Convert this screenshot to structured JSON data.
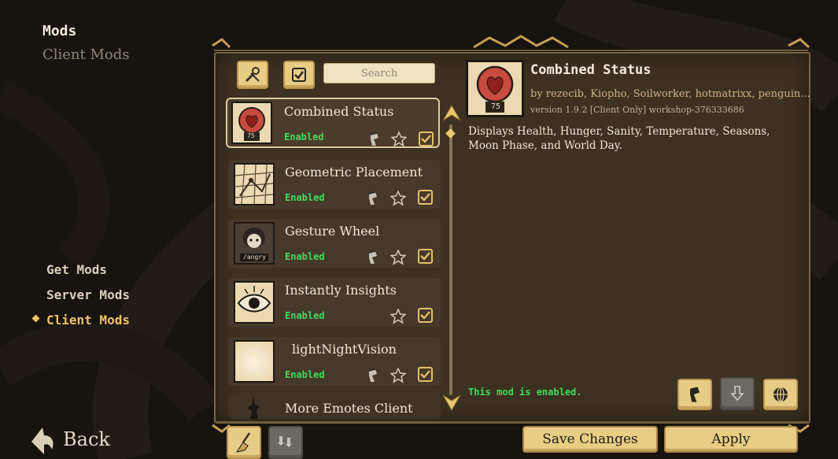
{
  "header": {
    "title": "Mods",
    "subtitle": "Client Mods"
  },
  "nav": {
    "items": [
      {
        "label": "Get Mods",
        "active": false
      },
      {
        "label": "Server Mods",
        "active": false
      },
      {
        "label": "Client Mods",
        "active": true
      }
    ]
  },
  "back_label": "Back",
  "search": {
    "placeholder": "Search",
    "value": ""
  },
  "toolbar_icons": [
    "wrench-tools-icon",
    "checkbox-icon"
  ],
  "mods": [
    {
      "name": "Combined Status",
      "status": "Enabled",
      "selected": true,
      "thumb": "heart-badge",
      "badge": "75",
      "has_config": true,
      "favorite": false,
      "enabled": true
    },
    {
      "name": "Geometric Placement",
      "status": "Enabled",
      "selected": false,
      "thumb": "grid-map",
      "has_config": true,
      "favorite": false,
      "enabled": true
    },
    {
      "name": "Gesture Wheel",
      "status": "Enabled",
      "selected": false,
      "thumb": "character-portrait",
      "badge": "/angry",
      "has_config": true,
      "favorite": false,
      "enabled": true
    },
    {
      "name": "Instantly Insights",
      "status": "Enabled",
      "selected": false,
      "thumb": "eye",
      "has_config": false,
      "favorite": false,
      "enabled": true
    },
    {
      "name": "lightNightVision",
      "status": "Enabled",
      "selected": false,
      "thumb": "blank-glow",
      "has_config": true,
      "favorite": false,
      "enabled": true
    },
    {
      "name": "More Emotes Client",
      "status": "",
      "selected": false,
      "thumb": "silhouette",
      "partial": true
    }
  ],
  "detail": {
    "title": "Combined Status",
    "badge": "75",
    "authors": "by rezecib, Kiopho, Soilworker, hotmatrixx, penguin...",
    "version": "version 1.9.2  [Client Only]  workshop-376333686",
    "description": "Displays Health, Hunger, Sanity, Temperature, Seasons, Moon Phase, and World Day.",
    "status": "This mod is enabled."
  },
  "footer": {
    "save_label": "Save Changes",
    "apply_label": "Apply"
  },
  "colors": {
    "accent": "#f0c268",
    "enabled": "#3fdc5f",
    "panel": "#3d3121",
    "button": "#e9cd84"
  }
}
